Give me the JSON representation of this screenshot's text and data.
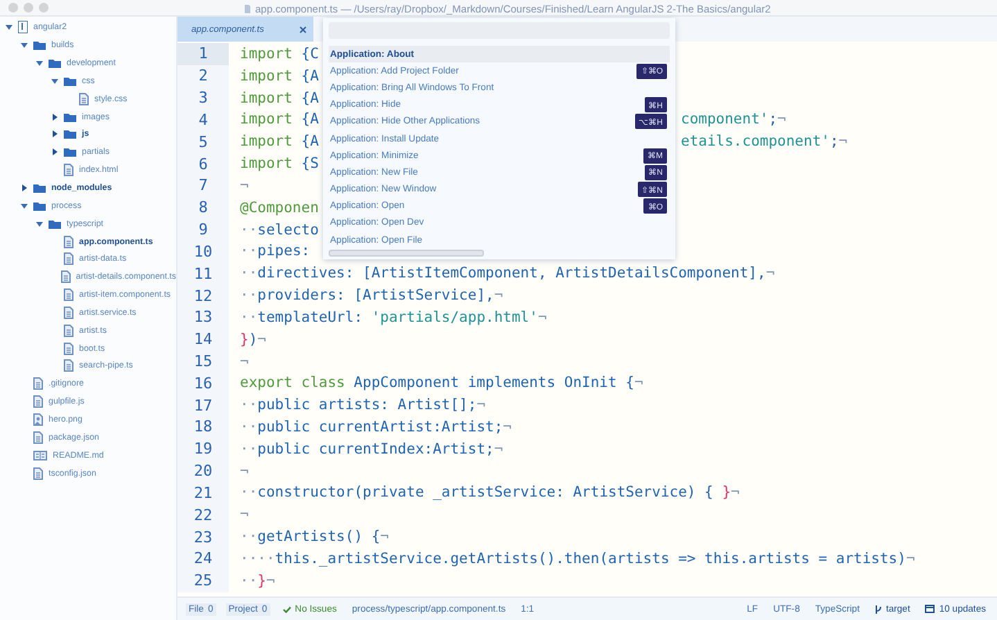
{
  "window": {
    "title": "app.component.ts — /Users/ray/Dropbox/_Markdown/Courses/Finished/Learn AngularJS 2-The Basics/angular2"
  },
  "tree": [
    {
      "label": "angular2",
      "kind": "repo",
      "expanded": true,
      "children": [
        {
          "label": "builds",
          "kind": "folder",
          "expanded": true,
          "children": [
            {
              "label": "development",
              "kind": "folder",
              "expanded": true,
              "children": [
                {
                  "label": "css",
                  "kind": "folder",
                  "expanded": true,
                  "children": [
                    {
                      "label": "style.css",
                      "kind": "file",
                      "selected": false,
                      "emphasized": false
                    }
                  ],
                  "emphasized": false
                },
                {
                  "label": "images",
                  "kind": "folder",
                  "expanded": false,
                  "emphasized": false
                },
                {
                  "label": "js",
                  "kind": "folder",
                  "expanded": false,
                  "emphasized": true
                },
                {
                  "label": "partials",
                  "kind": "folder",
                  "expanded": false,
                  "emphasized": false
                },
                {
                  "label": "index.html",
                  "kind": "file",
                  "selected": false,
                  "emphasized": false
                }
              ],
              "emphasized": false
            }
          ],
          "emphasized": false
        },
        {
          "label": "node_modules",
          "kind": "folder",
          "expanded": false,
          "emphasized": true
        },
        {
          "label": "process",
          "kind": "folder",
          "expanded": true,
          "emphasized": false,
          "children": [
            {
              "label": "typescript",
              "kind": "folder",
              "expanded": true,
              "emphasized": false,
              "children": [
                {
                  "label": "app.component.ts",
                  "kind": "file",
                  "selected": true,
                  "emphasized": false
                },
                {
                  "label": "artist-data.ts",
                  "kind": "file",
                  "selected": false,
                  "emphasized": false
                },
                {
                  "label": "artist-details.component.ts",
                  "kind": "file",
                  "selected": false,
                  "emphasized": false
                },
                {
                  "label": "artist-item.component.ts",
                  "kind": "file",
                  "selected": false,
                  "emphasized": false
                },
                {
                  "label": "artist.service.ts",
                  "kind": "file",
                  "selected": false,
                  "emphasized": false
                },
                {
                  "label": "artist.ts",
                  "kind": "file",
                  "selected": false,
                  "emphasized": false
                },
                {
                  "label": "boot.ts",
                  "kind": "file",
                  "selected": false,
                  "emphasized": false
                },
                {
                  "label": "search-pipe.ts",
                  "kind": "file",
                  "selected": false,
                  "emphasized": false
                }
              ]
            }
          ]
        },
        {
          "label": ".gitignore",
          "kind": "file",
          "selected": false,
          "emphasized": false
        },
        {
          "label": "gulpfile.js",
          "kind": "file",
          "selected": false,
          "emphasized": false
        },
        {
          "label": "hero.png",
          "kind": "image",
          "selected": false,
          "emphasized": false
        },
        {
          "label": "package.json",
          "kind": "file",
          "selected": false,
          "emphasized": false
        },
        {
          "label": "README.md",
          "kind": "readme",
          "selected": false,
          "emphasized": false
        },
        {
          "label": "tsconfig.json",
          "kind": "file",
          "selected": false,
          "emphasized": false
        }
      ],
      "emphasized": false
    }
  ],
  "tabs": [
    {
      "label": "app.component.ts",
      "selected": true
    }
  ],
  "editor": {
    "lines": [
      {
        "number": "1",
        "current": true,
        "tokens": [
          {
            "kind": "keyword",
            "text": "import"
          },
          {
            "kind": "name",
            "text": " {C"
          }
        ]
      },
      {
        "number": "2",
        "current": false,
        "tokens": [
          {
            "kind": "keyword",
            "text": "import"
          },
          {
            "kind": "name",
            "text": " {A"
          }
        ]
      },
      {
        "number": "3",
        "current": false,
        "tokens": [
          {
            "kind": "keyword",
            "text": "import"
          },
          {
            "kind": "name",
            "text": " {A"
          }
        ]
      },
      {
        "number": "4",
        "current": false,
        "tokens": [
          {
            "kind": "keyword",
            "text": "import"
          },
          {
            "kind": "name",
            "text": " {A"
          }
        ],
        "tail": [
          {
            "kind": "string",
            "text": "component'"
          },
          {
            "kind": "name",
            "text": ";"
          },
          {
            "kind": "invisible",
            "text": "¬"
          }
        ]
      },
      {
        "number": "5",
        "current": false,
        "tokens": [
          {
            "kind": "keyword",
            "text": "import"
          },
          {
            "kind": "name",
            "text": " {A"
          }
        ],
        "tail": [
          {
            "kind": "string",
            "text": "etails.component'"
          },
          {
            "kind": "name",
            "text": ";"
          },
          {
            "kind": "invisible",
            "text": "¬"
          }
        ]
      },
      {
        "number": "6",
        "current": false,
        "tokens": [
          {
            "kind": "keyword",
            "text": "import"
          },
          {
            "kind": "name",
            "text": " {S"
          }
        ]
      },
      {
        "number": "7",
        "current": false,
        "tokens": [
          {
            "kind": "invisible",
            "text": "¬"
          }
        ]
      },
      {
        "number": "8",
        "current": false,
        "tokens": [
          {
            "kind": "keyword",
            "text": "@Componen"
          }
        ]
      },
      {
        "number": "9",
        "current": false,
        "tokens": [
          {
            "kind": "invisible",
            "text": "··"
          },
          {
            "kind": "name",
            "text": "selecto"
          }
        ]
      },
      {
        "number": "10",
        "current": false,
        "tokens": [
          {
            "kind": "invisible",
            "text": "··"
          },
          {
            "kind": "name",
            "text": "pipes:"
          }
        ]
      },
      {
        "number": "11",
        "current": false,
        "tokens": [
          {
            "kind": "invisible",
            "text": "··"
          },
          {
            "kind": "name",
            "text": "directives: [ArtistItemComponent, ArtistDetailsComponent],"
          },
          {
            "kind": "invisible",
            "text": "¬"
          }
        ]
      },
      {
        "number": "12",
        "current": false,
        "tokens": [
          {
            "kind": "invisible",
            "text": "··"
          },
          {
            "kind": "name",
            "text": "providers: [ArtistService],"
          },
          {
            "kind": "invisible",
            "text": "¬"
          }
        ]
      },
      {
        "number": "13",
        "current": false,
        "tokens": [
          {
            "kind": "invisible",
            "text": "··"
          },
          {
            "kind": "name",
            "text": "templateUrl: "
          },
          {
            "kind": "string",
            "text": "'partials/app.html'"
          },
          {
            "kind": "invisible",
            "text": "¬"
          }
        ]
      },
      {
        "number": "14",
        "current": false,
        "tokens": [
          {
            "kind": "brace",
            "text": "}"
          },
          {
            "kind": "name",
            "text": ")"
          },
          {
            "kind": "invisible",
            "text": "¬"
          }
        ]
      },
      {
        "number": "15",
        "current": false,
        "tokens": [
          {
            "kind": "invisible",
            "text": "¬"
          }
        ]
      },
      {
        "number": "16",
        "current": false,
        "tokens": [
          {
            "kind": "keyword",
            "text": "export class"
          },
          {
            "kind": "name",
            "text": " AppComponent implements OnInit {"
          },
          {
            "kind": "invisible",
            "text": "¬"
          }
        ]
      },
      {
        "number": "17",
        "current": false,
        "tokens": [
          {
            "kind": "invisible",
            "text": "··"
          },
          {
            "kind": "name",
            "text": "public artists: Artist[];"
          },
          {
            "kind": "invisible",
            "text": "¬"
          }
        ]
      },
      {
        "number": "18",
        "current": false,
        "tokens": [
          {
            "kind": "invisible",
            "text": "··"
          },
          {
            "kind": "name",
            "text": "public currentArtist:Artist;"
          },
          {
            "kind": "invisible",
            "text": "¬"
          }
        ]
      },
      {
        "number": "19",
        "current": false,
        "tokens": [
          {
            "kind": "invisible",
            "text": "··"
          },
          {
            "kind": "name",
            "text": "public currentIndex:Artist;"
          },
          {
            "kind": "invisible",
            "text": "¬"
          }
        ]
      },
      {
        "number": "20",
        "current": false,
        "tokens": [
          {
            "kind": "invisible",
            "text": "¬"
          }
        ]
      },
      {
        "number": "21",
        "current": false,
        "tokens": [
          {
            "kind": "invisible",
            "text": "··"
          },
          {
            "kind": "name",
            "text": "constructor(private _artistService: ArtistService) { "
          },
          {
            "kind": "brace",
            "text": "}"
          },
          {
            "kind": "invisible",
            "text": "¬"
          }
        ]
      },
      {
        "number": "22",
        "current": false,
        "tokens": [
          {
            "kind": "invisible",
            "text": "¬"
          }
        ]
      },
      {
        "number": "23",
        "current": false,
        "tokens": [
          {
            "kind": "invisible",
            "text": "··"
          },
          {
            "kind": "name",
            "text": "getArtists() {"
          },
          {
            "kind": "invisible",
            "text": "¬"
          }
        ]
      },
      {
        "number": "24",
        "current": false,
        "tokens": [
          {
            "kind": "invisible",
            "text": "····"
          },
          {
            "kind": "name",
            "text": "this._artistService.getArtists().then(artists => this.artists = artists)"
          },
          {
            "kind": "invisible",
            "text": "¬"
          }
        ]
      },
      {
        "number": "25",
        "current": false,
        "tokens": [
          {
            "kind": "invisible",
            "text": "··"
          },
          {
            "kind": "brace",
            "text": "}"
          },
          {
            "kind": "invisible",
            "text": "¬"
          }
        ]
      }
    ]
  },
  "command_palette": {
    "items": [
      {
        "label": "Application: About",
        "selected": true
      },
      {
        "label": "Application: Add Project Folder",
        "selected": false,
        "shortcut": "⇧⌘O"
      },
      {
        "label": "Application: Bring All Windows To Front",
        "selected": false
      },
      {
        "label": "Application: Hide",
        "selected": false,
        "shortcut": "⌘H"
      },
      {
        "label": "Application: Hide Other Applications",
        "selected": false,
        "shortcut": "⌥⌘H"
      },
      {
        "label": "Application: Install Update",
        "selected": false
      },
      {
        "label": "Application: Minimize",
        "selected": false,
        "shortcut": "⌘M"
      },
      {
        "label": "Application: New File",
        "selected": false,
        "shortcut": "⌘N"
      },
      {
        "label": "Application: New Window",
        "selected": false,
        "shortcut": "⇧⌘N"
      },
      {
        "label": "Application: Open",
        "selected": false,
        "shortcut": "⌘O"
      },
      {
        "label": "Application: Open Dev",
        "selected": false
      },
      {
        "label": "Application: Open File",
        "selected": false
      }
    ]
  },
  "status_bar": {
    "left": [
      {
        "kind": "counter",
        "label": "File",
        "count": "0"
      },
      {
        "kind": "counter",
        "label": "Project",
        "count": "0"
      },
      {
        "kind": "lint",
        "label": "No Issues"
      },
      {
        "kind": "text",
        "label": "process/typescript/app.component.ts"
      },
      {
        "kind": "text",
        "label": "1:1"
      }
    ],
    "right": [
      {
        "kind": "text",
        "label": "LF"
      },
      {
        "kind": "text",
        "label": "UTF-8"
      },
      {
        "kind": "text",
        "label": "TypeScript"
      },
      {
        "kind": "branch",
        "label": "target"
      },
      {
        "kind": "updates",
        "label": "10 updates"
      }
    ]
  }
}
